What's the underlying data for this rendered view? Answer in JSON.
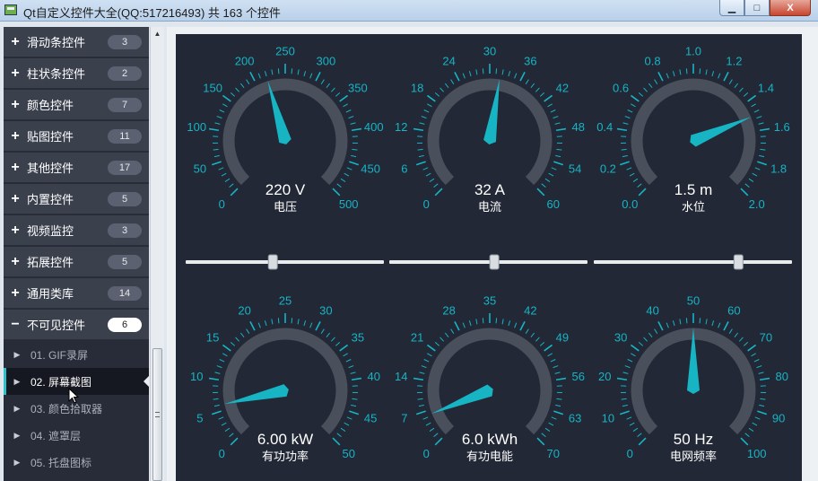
{
  "window": {
    "title": "Qt自定义控件大全(QQ:517216493) 共 163 个控件",
    "buttons": {
      "minimize": "▁",
      "maximize": "□",
      "close": "X"
    }
  },
  "sidebar": {
    "groups": [
      {
        "label": "滑动条控件",
        "count": "3"
      },
      {
        "label": "柱状条控件",
        "count": "2"
      },
      {
        "label": "颜色控件",
        "count": "7"
      },
      {
        "label": "贴图控件",
        "count": "11"
      },
      {
        "label": "其他控件",
        "count": "17"
      },
      {
        "label": "内置控件",
        "count": "5"
      },
      {
        "label": "视频监控",
        "count": "3"
      },
      {
        "label": "拓展控件",
        "count": "5"
      },
      {
        "label": "通用类库",
        "count": "14"
      },
      {
        "label": "不可见控件",
        "count": "6",
        "expanded": true,
        "toggle": "−"
      }
    ],
    "plus": "+",
    "children": [
      {
        "label": "01. GIF录屏"
      },
      {
        "label": "02. 屏幕截图",
        "selected": true
      },
      {
        "label": "03. 颜色拾取器"
      },
      {
        "label": "04. 遮罩层"
      },
      {
        "label": "05. 托盘图标"
      }
    ]
  },
  "colors": {
    "accent": "#17b4c4",
    "dial_ring": "#4a4f5c",
    "panel": "#222836",
    "text": "#ffffff"
  },
  "gauges": [
    {
      "name": "voltage",
      "ticks": [
        "0",
        "50",
        "100",
        "150",
        "200",
        "250",
        "300",
        "350",
        "400",
        "450",
        "500"
      ],
      "value": 220,
      "min": 0,
      "max": 500,
      "display": "220 V",
      "label": "电压"
    },
    {
      "name": "current",
      "ticks": [
        "0",
        "6",
        "12",
        "18",
        "24",
        "30",
        "36",
        "42",
        "48",
        "54",
        "60"
      ],
      "value": 32,
      "min": 0,
      "max": 60,
      "display": "32 A",
      "label": "电流"
    },
    {
      "name": "water-level",
      "ticks": [
        "0.0",
        "0.2",
        "0.4",
        "0.6",
        "0.8",
        "1.0",
        "1.2",
        "1.4",
        "1.6",
        "1.8",
        "2.0"
      ],
      "value": 1.5,
      "min": 0,
      "max": 2,
      "display": "1.5 m",
      "label": "水位"
    },
    {
      "name": "active-power",
      "ticks": [
        "0",
        "5",
        "10",
        "15",
        "20",
        "25",
        "30",
        "35",
        "40",
        "45",
        "50"
      ],
      "value": 6,
      "min": 0,
      "max": 50,
      "display": "6.00 kW",
      "label": "有功功率"
    },
    {
      "name": "active-energy",
      "ticks": [
        "0",
        "7",
        "14",
        "21",
        "28",
        "35",
        "42",
        "49",
        "56",
        "63",
        "70"
      ],
      "value": 6,
      "min": 0,
      "max": 70,
      "display": "6.0 kWh",
      "label": "有功电能"
    },
    {
      "name": "grid-frequency",
      "ticks": [
        "0",
        "10",
        "20",
        "30",
        "40",
        "50",
        "60",
        "70",
        "80",
        "90",
        "100"
      ],
      "value": 50,
      "min": 0,
      "max": 100,
      "display": "50 Hz",
      "label": "电网频率"
    }
  ],
  "sliders": [
    {
      "name": "slider-voltage",
      "value": 0.44
    },
    {
      "name": "slider-current",
      "value": 0.53
    },
    {
      "name": "slider-water-level",
      "value": 0.73
    }
  ],
  "icons": {
    "app": "app-window-icon",
    "cursor": "mouse-cursor-icon",
    "child_arrow": "▶",
    "scroll_up": "▲"
  }
}
